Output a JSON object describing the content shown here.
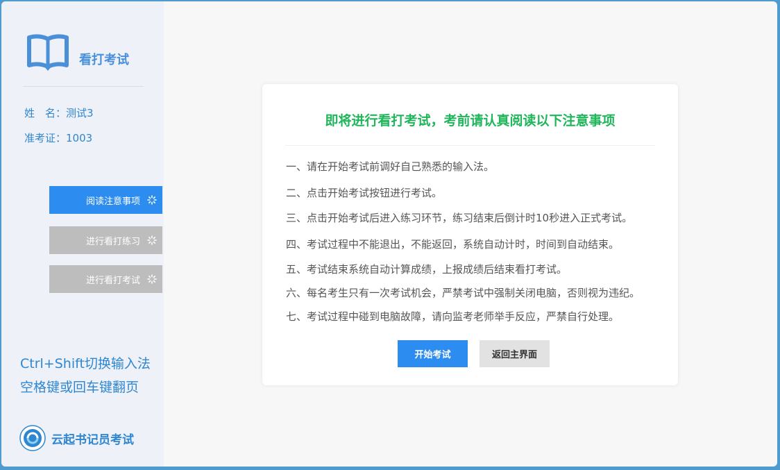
{
  "sidebar": {
    "app_title": "看打考试",
    "name_line": "姓　名：测试3",
    "ticket_line": "准考证：1003",
    "nav": [
      {
        "label": "阅读注意事项",
        "active": true
      },
      {
        "label": "进行看打练习",
        "active": false
      },
      {
        "label": "进行看打考试",
        "active": false
      }
    ],
    "tips": [
      "Ctrl+Shift切换输入法",
      "空格键或回车键翻页"
    ],
    "brand": "云起书记员考试"
  },
  "main": {
    "title": "即将进行看打考试，考前请认真阅读以下注意事项",
    "rules": [
      "一、请在开始考试前调好自己熟悉的输入法。",
      "二、点击开始考试按钮进行考试。",
      "三、点击开始考试后进入练习环节，练习结束后倒计时10秒进入正式考试。",
      "四、考试过程中不能退出，不能返回，系统自动计时，时间到自动结束。",
      "五、考试结束系统自动计算成绩，上报成绩后结束看打考试。",
      "六、每名考生只有一次考试机会，严禁考试中强制关闭电脑，否则视为违纪。",
      "七、考试过程中碰到电脑故障，请向监考老师举手反应，严禁自行处理。"
    ],
    "start_button": "开始考试",
    "back_button": "返回主界面"
  },
  "colors": {
    "accent": "#2d8cf0",
    "title_green": "#1fb55a",
    "sidebar_text": "#2f86d0",
    "inactive": "#bdbdbd"
  }
}
